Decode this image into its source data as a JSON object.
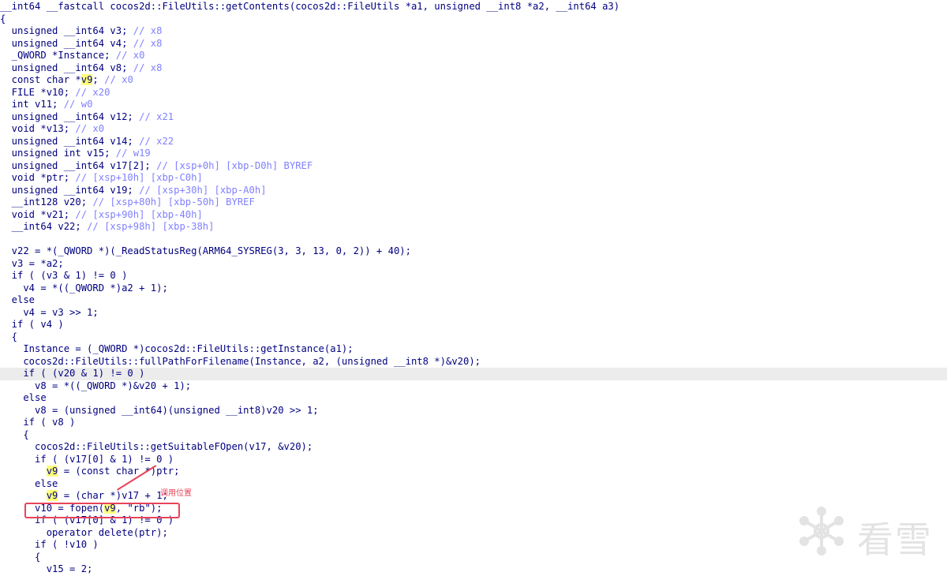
{
  "code_lines": [
    {
      "text": "__int64 __fastcall cocos2d::FileUtils::getContents(cocos2d::FileUtils *a1, unsigned __int8 *a2, __int64 a3)"
    },
    {
      "text": "{"
    },
    {
      "text": "  unsigned __int64 v3; // x8"
    },
    {
      "text": "  unsigned __int64 v4; // x8"
    },
    {
      "text": "  _QWORD *Instance; // x0"
    },
    {
      "text": "  unsigned __int64 v8; // x8"
    },
    {
      "text": "  const char *v9; // x0"
    },
    {
      "text": "  FILE *v10; // x20"
    },
    {
      "text": "  int v11; // w0"
    },
    {
      "text": "  unsigned __int64 v12; // x21"
    },
    {
      "text": "  void *v13; // x0"
    },
    {
      "text": "  unsigned __int64 v14; // x22"
    },
    {
      "text": "  unsigned int v15; // w19"
    },
    {
      "text": "  unsigned __int64 v17[2]; // [xsp+0h] [xbp-D0h] BYREF"
    },
    {
      "text": "  void *ptr; // [xsp+10h] [xbp-C0h]"
    },
    {
      "text": "  unsigned __int64 v19; // [xsp+30h] [xbp-A0h]"
    },
    {
      "text": "  __int128 v20; // [xsp+80h] [xbp-50h] BYREF"
    },
    {
      "text": "  void *v21; // [xsp+90h] [xbp-40h]"
    },
    {
      "text": "  __int64 v22; // [xsp+98h] [xbp-38h]"
    },
    {
      "text": ""
    },
    {
      "text": "  v22 = *(_QWORD *)(_ReadStatusReg(ARM64_SYSREG(3, 3, 13, 0, 2)) + 40);"
    },
    {
      "text": "  v3 = *a2;"
    },
    {
      "text": "  if ( (v3 & 1) != 0 )"
    },
    {
      "text": "    v4 = *((_QWORD *)a2 + 1);"
    },
    {
      "text": "  else"
    },
    {
      "text": "    v4 = v3 >> 1;"
    },
    {
      "text": "  if ( v4 )"
    },
    {
      "text": "  {"
    },
    {
      "text": "    Instance = (_QWORD *)cocos2d::FileUtils::getInstance(a1);"
    },
    {
      "text": "    cocos2d::FileUtils::fullPathForFilename(Instance, a2, (unsigned __int8 *)&v20);"
    },
    {
      "text": "    if ( (v20 & 1) != 0 )",
      "highlight": true
    },
    {
      "text": "      v8 = *((_QWORD *)&v20 + 1);"
    },
    {
      "text": "    else"
    },
    {
      "text": "      v8 = (unsigned __int64)(unsigned __int8)v20 >> 1;"
    },
    {
      "text": "    if ( v8 )"
    },
    {
      "text": "    {"
    },
    {
      "text": "      cocos2d::FileUtils::getSuitableFOpen(v17, &v20);"
    },
    {
      "text": "      if ( (v17[0] & 1) != 0 )"
    },
    {
      "text": "        v9 = (const char *)ptr;"
    },
    {
      "text": "      else"
    },
    {
      "text": "        v9 = (char *)v17 + 1;"
    },
    {
      "text": "      v10 = fopen(v9, \"rb\");"
    },
    {
      "text": "      if ( (v17[0] & 1) != 0 )"
    },
    {
      "text": "        operator delete(ptr);"
    },
    {
      "text": "      if ( !v10 )"
    },
    {
      "text": "      {"
    },
    {
      "text": "        v15 = 2;"
    }
  ],
  "annotation": {
    "label": "调用位置"
  },
  "watermark": {
    "text": "看雪",
    "icon": "snowflake-icon"
  }
}
